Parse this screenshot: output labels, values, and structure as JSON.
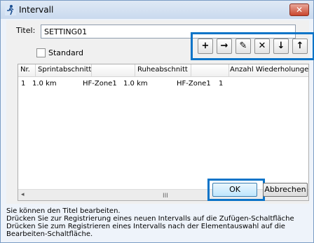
{
  "window": {
    "title": "Intervall",
    "close_symbol": "✕"
  },
  "form": {
    "title_label": "Titel:",
    "title_value": "SETTING01",
    "standard_label": "Standard"
  },
  "toolbar": {
    "add": "+",
    "next": "→",
    "edit": "✎",
    "delete": "✕",
    "down": "↓",
    "up": "↑"
  },
  "table": {
    "headers": [
      "Nr.",
      "Sprintabschnitt",
      "",
      "Ruheabschnitt",
      "",
      "Anzahl Wiederholungen"
    ],
    "rows": [
      [
        "1",
        "1.0 km",
        "HF-Zone1",
        "1.0 km",
        "HF-Zone1",
        "1"
      ]
    ]
  },
  "scrollbar": {
    "left": "◂",
    "right": "▸",
    "thumb": "III"
  },
  "buttons": {
    "ok": "OK",
    "cancel": "Abbrechen"
  },
  "hint": {
    "line1": "Sie können den Titel bearbeiten.",
    "line2": "Drücken Sie zur Registrierung eines neuen Intervalls auf die Zufügen-Schaltfläche",
    "line3": "Drücken Sie zum Registrieren eines Intervalls nach der Elementauswahl auf die",
    "line4": "Bearbeiten-Schaltfläche."
  },
  "colors": {
    "highlight": "#0b74c8",
    "titlebar": "#c9d9ee"
  }
}
